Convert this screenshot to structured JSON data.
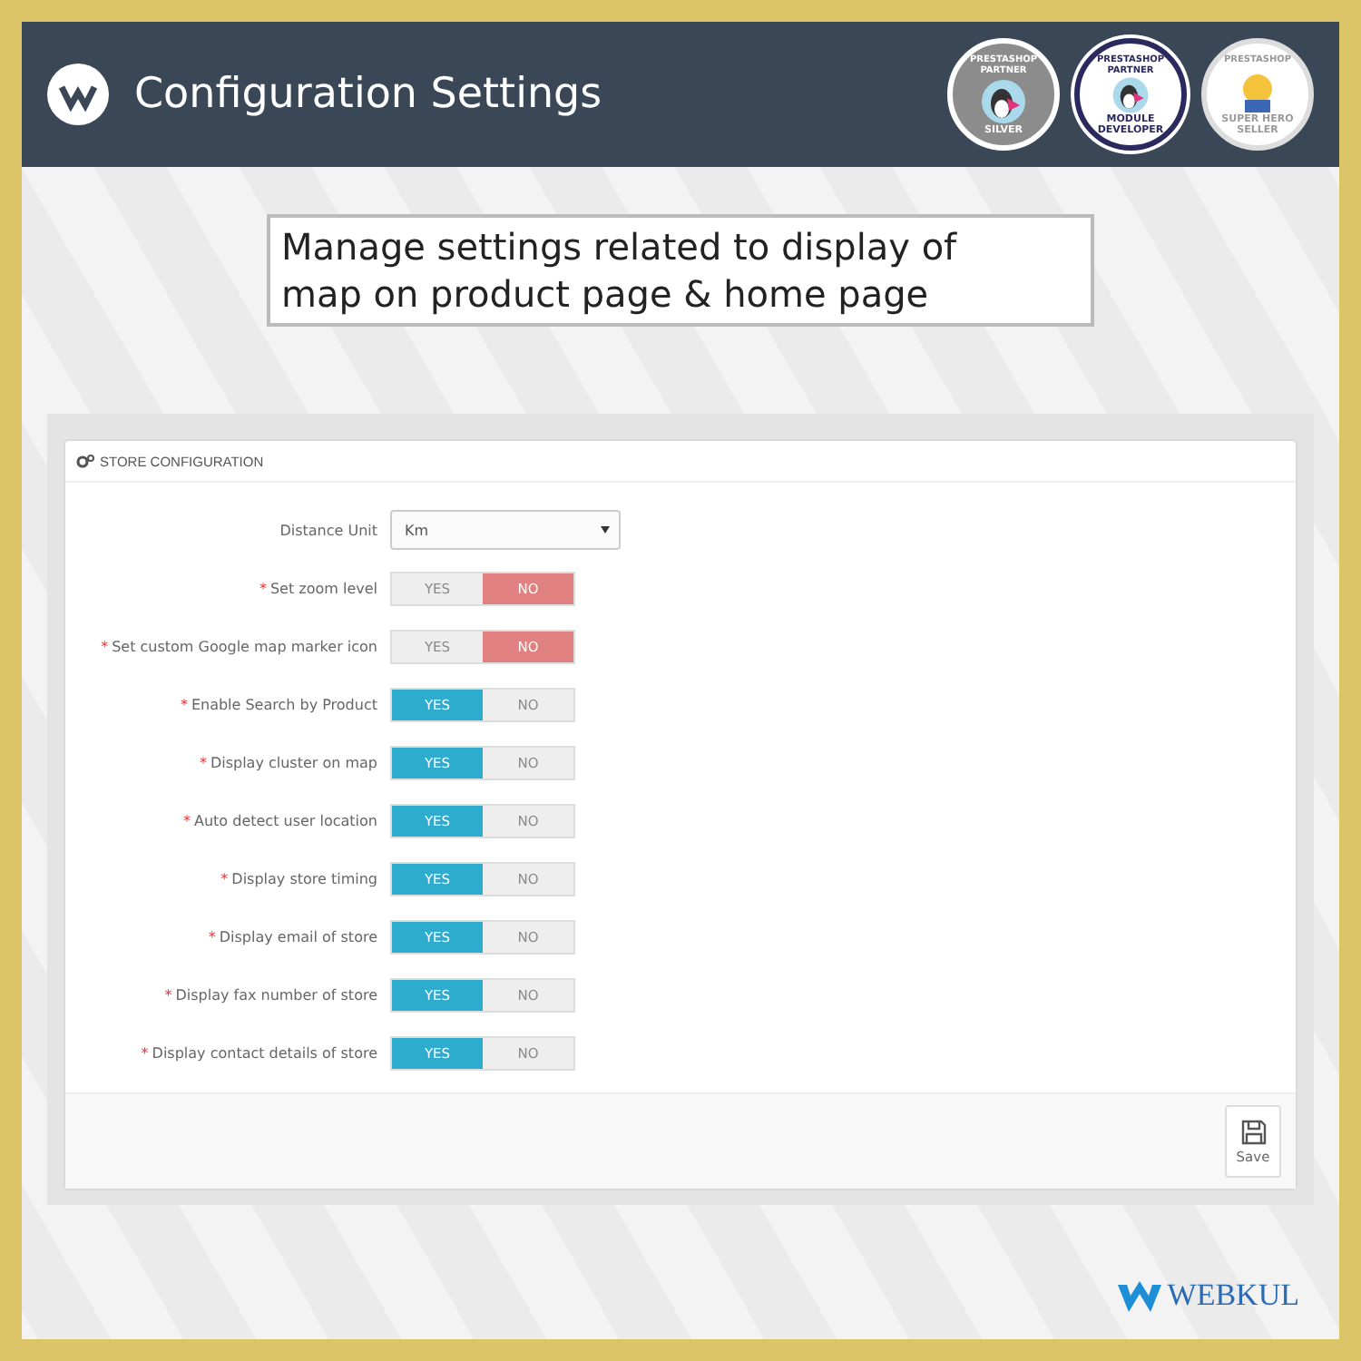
{
  "header": {
    "title": "Configuration Settings",
    "badges": [
      {
        "top": "PRESTASHOP PARTNER",
        "bottom": "SILVER"
      },
      {
        "top": "PRESTASHOP PARTNER",
        "bottom": "MODULE DEVELOPER"
      },
      {
        "top": "PRESTASHOP",
        "bottom": "SUPER HERO SELLER"
      }
    ]
  },
  "caption": "Manage settings related to display of map on product page & home page",
  "panel": {
    "title": "STORE CONFIGURATION",
    "fields": [
      {
        "kind": "select",
        "label": "Distance Unit",
        "value": "Km"
      },
      {
        "kind": "toggle",
        "mark": "*",
        "label": "Set zoom level",
        "yes": "YES",
        "no": "NO",
        "on": false
      },
      {
        "kind": "toggle",
        "mark": "*",
        "label": "Set custom Google map marker icon",
        "yes": "YES",
        "no": "NO",
        "on": false
      },
      {
        "kind": "toggle",
        "mark": "*",
        "label": "Enable Search by Product",
        "yes": "YES",
        "no": "NO",
        "on": true
      },
      {
        "kind": "toggle",
        "mark": "*",
        "label": "Display cluster on map",
        "yes": "YES",
        "no": "NO",
        "on": true
      },
      {
        "kind": "toggle",
        "mark": "*",
        "label": "Auto detect user location",
        "yes": "YES",
        "no": "NO",
        "on": true
      },
      {
        "kind": "toggle",
        "mark": "*",
        "label": "Display store timing",
        "yes": "YES",
        "no": "NO",
        "on": true
      },
      {
        "kind": "toggle",
        "mark": "*",
        "label": "Display email of store",
        "yes": "YES",
        "no": "NO",
        "on": true
      },
      {
        "kind": "toggle",
        "mark": "*",
        "label": "Display fax number of store",
        "yes": "YES",
        "no": "NO",
        "on": true
      },
      {
        "kind": "toggle",
        "mark": "*",
        "label": "Display contact details of store",
        "yes": "YES",
        "no": "NO",
        "on": true
      }
    ],
    "save": "Save"
  },
  "brand": "WEBKUL"
}
